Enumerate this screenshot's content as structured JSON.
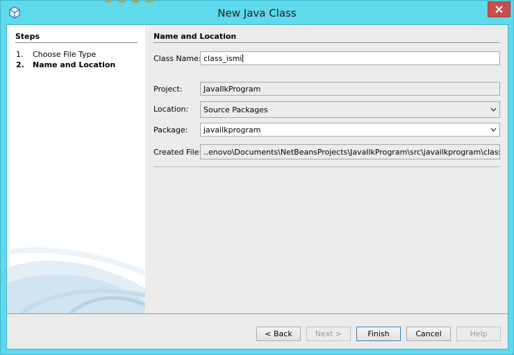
{
  "window": {
    "title": "New Java Class"
  },
  "steps": {
    "title": "Steps",
    "items": [
      {
        "num": "1.",
        "label": "Choose File Type"
      },
      {
        "num": "2.",
        "label": "Name and Location"
      }
    ]
  },
  "form": {
    "section_title": "Name and Location",
    "class_name": {
      "label": "Class Name:",
      "value": "class_ismi"
    },
    "project": {
      "label": "Project:",
      "value": "JavaIlkProgram"
    },
    "location": {
      "label": "Location:",
      "value": "Source Packages"
    },
    "package": {
      "label": "Package:",
      "value": "javailkprogram"
    },
    "created_file": {
      "label": "Created File:",
      "value": "..enovo\\Documents\\NetBeansProjects\\JavaIlkProgram\\src\\javailkprogram\\class_ismi.java"
    }
  },
  "buttons": {
    "back": "< Back",
    "next": "Next >",
    "finish": "Finish",
    "cancel": "Cancel",
    "help": "Help"
  }
}
